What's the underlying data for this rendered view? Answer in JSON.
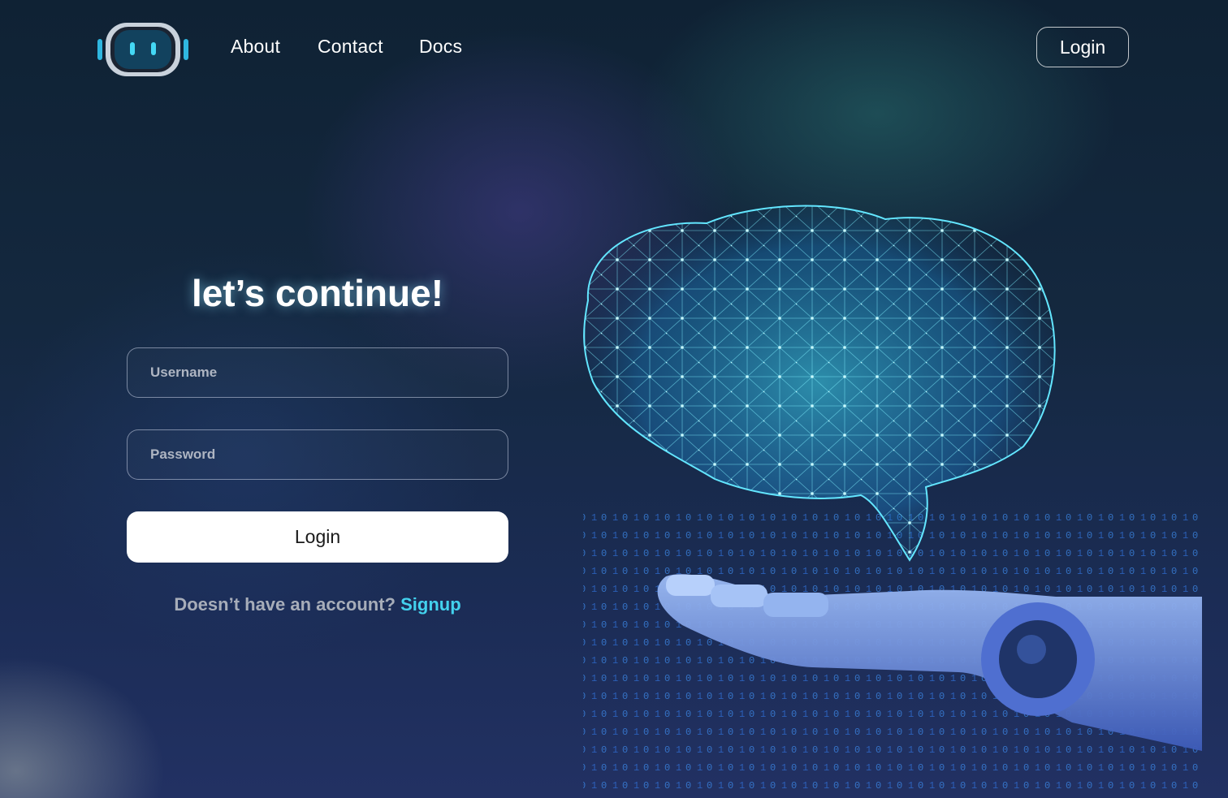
{
  "nav": {
    "logo_icon": "robot-head-icon",
    "links": [
      "About",
      "Contact",
      "Docs"
    ],
    "login_label": "Login"
  },
  "form": {
    "title": "let’s continue!",
    "username_placeholder": "Username",
    "password_placeholder": "Password",
    "login_label": "Login",
    "signup_prompt": "Doesn’t have an account?",
    "signup_link": "Signup"
  },
  "hero": {
    "image": "ai-brain-robot-hand-illustration"
  },
  "colors": {
    "accent": "#43d2ee",
    "background": "#14283f",
    "button_bg": "#ffffff"
  }
}
